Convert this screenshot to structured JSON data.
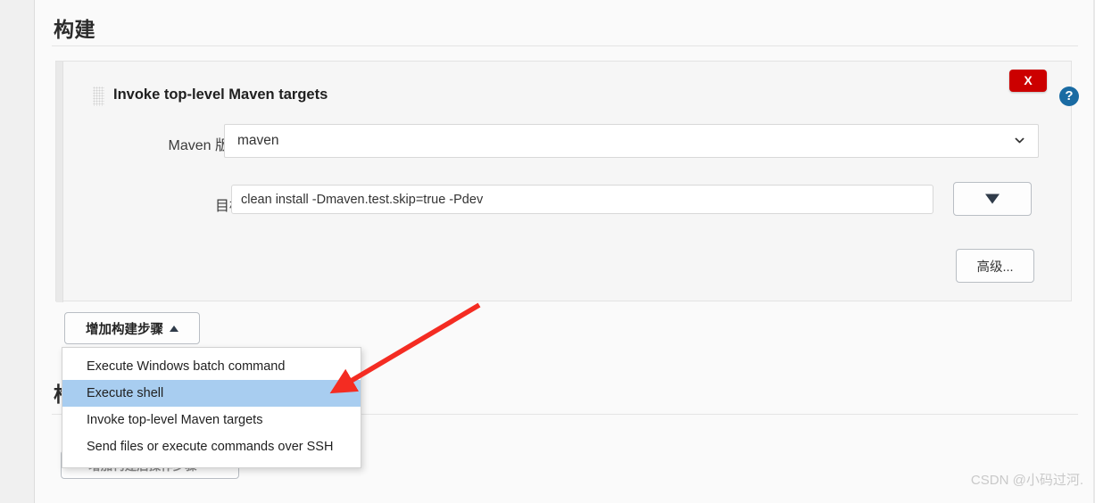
{
  "page": {
    "section_title": "构建",
    "section_title_2": "构建后操作",
    "watermark": "CSDN @小码过河."
  },
  "build_step": {
    "title": "Invoke top-level Maven targets",
    "drag_handle_icon": "drag-dots-icon",
    "delete_label": "X",
    "help_icon": "?",
    "maven_version": {
      "label": "Maven 版本",
      "value": "maven",
      "caret_icon": "chevron-down-icon",
      "options": [
        "maven"
      ]
    },
    "goals": {
      "label": "目标",
      "value": "clean install -Dmaven.test.skip=true -Pdev",
      "placeholder": ""
    },
    "dropdown_button_icon": "triangle-down-icon",
    "advanced_label": "高级..."
  },
  "add_step": {
    "label": "增加构建步骤",
    "caret_icon": "caret-up-icon",
    "menu_items": [
      {
        "label": "Execute Windows batch command",
        "selected": false
      },
      {
        "label": "Execute shell",
        "selected": true
      },
      {
        "label": "Invoke top-level Maven targets",
        "selected": false
      },
      {
        "label": "Send files or execute commands over SSH",
        "selected": false
      }
    ]
  },
  "post_build": {
    "label": "增加构建后操作步骤",
    "caret_icon": "caret-down-icon"
  },
  "colors": {
    "delete_red": "#cc0000",
    "help_blue": "#1a6ba3",
    "menu_highlight": "#a8cdf0",
    "annotation_red": "#f42c22",
    "panel_bg": "#f6f6f6",
    "page_bg": "#fafafa"
  }
}
